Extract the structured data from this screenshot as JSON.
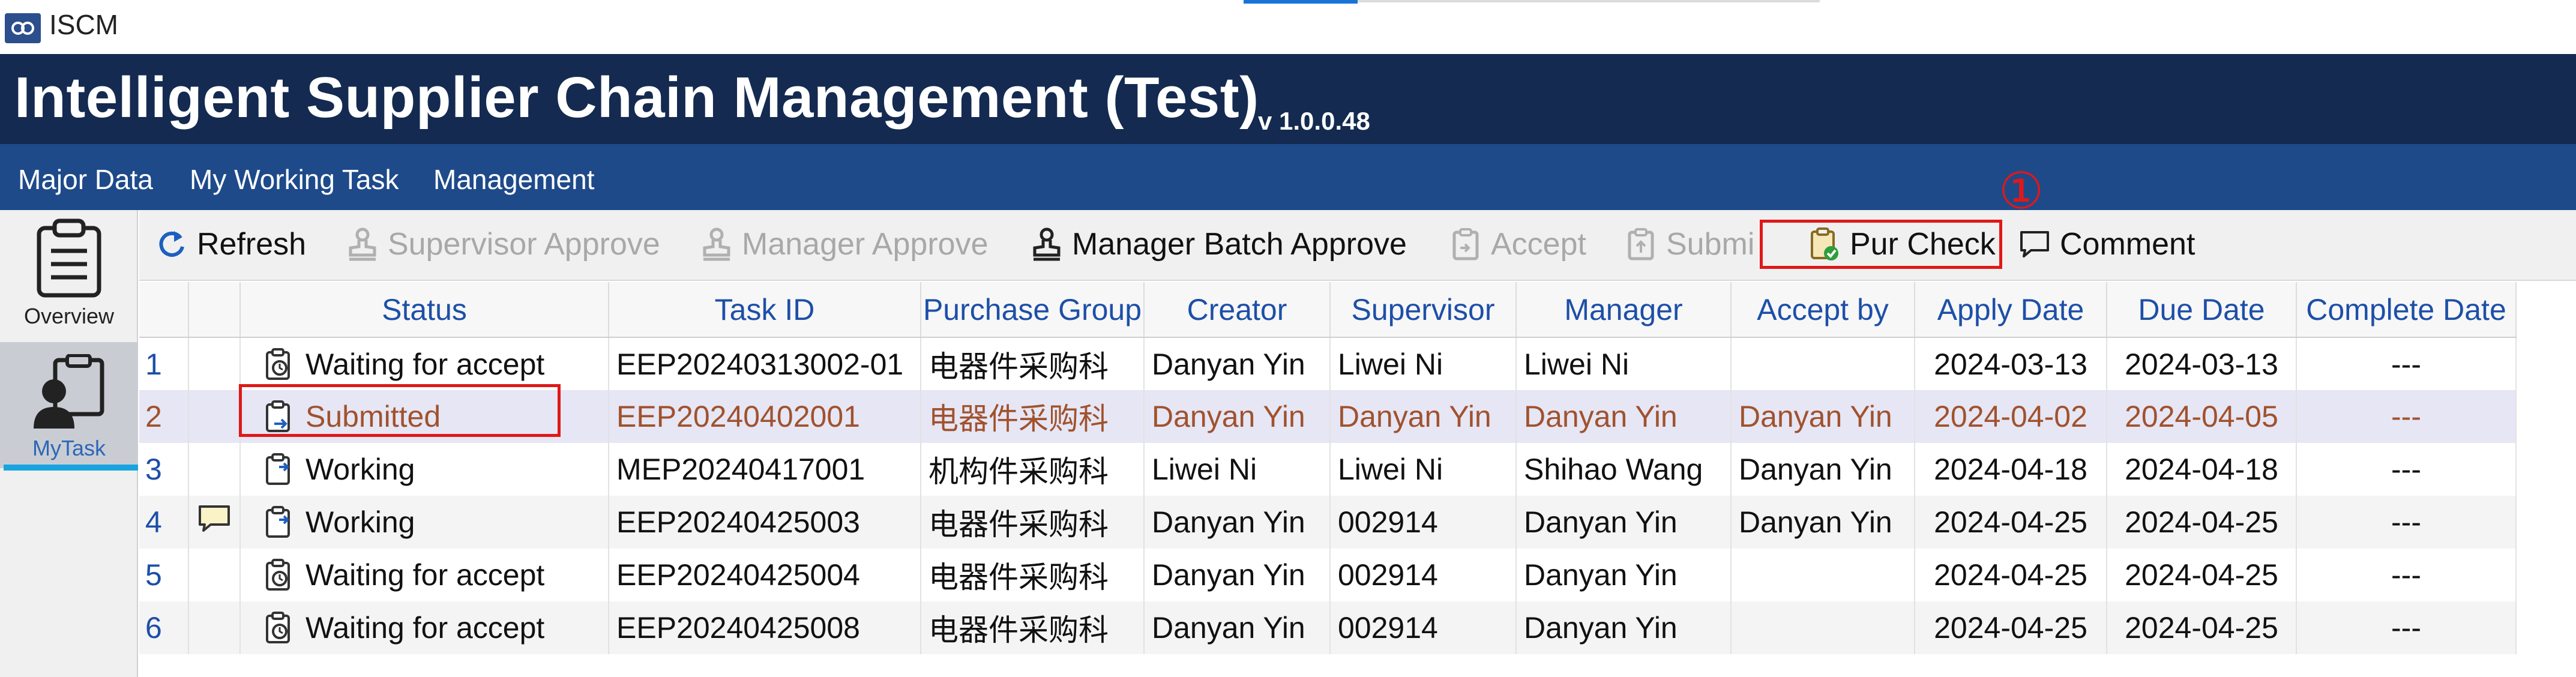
{
  "window": {
    "title": "ISCM"
  },
  "header": {
    "app_name": "Intelligent Supplier Chain Management (Test)",
    "version": "v 1.0.0.48"
  },
  "menu": {
    "items": [
      {
        "label": "Major Data"
      },
      {
        "label": "My Working Task"
      },
      {
        "label": "Management"
      }
    ]
  },
  "sidebar": {
    "items": [
      {
        "label": "Overview",
        "icon": "clipboard-list-icon"
      },
      {
        "label": "MyTask",
        "icon": "person-task-icon",
        "selected": true
      }
    ]
  },
  "toolbar": {
    "buttons": [
      {
        "label": "Refresh",
        "icon": "refresh-icon",
        "enabled": true
      },
      {
        "label": "Supervisor Approve",
        "icon": "stamp-icon",
        "enabled": false
      },
      {
        "label": "Manager Approve",
        "icon": "stamp-icon",
        "enabled": false
      },
      {
        "label": "Manager Batch Approve",
        "icon": "stamp-icon",
        "enabled": true
      },
      {
        "label": "Accept",
        "icon": "clipboard-accept-icon",
        "enabled": false
      },
      {
        "label": "Submi",
        "icon": "clipboard-submit-icon",
        "enabled": false
      },
      {
        "label": "Pur Check",
        "icon": "clipboard-check-icon",
        "enabled": true,
        "highlighted": true
      },
      {
        "label": "Comment",
        "icon": "comment-icon",
        "enabled": true
      }
    ],
    "annotation_marker": "①"
  },
  "table": {
    "columns": [
      "",
      "",
      "Status",
      "Task ID",
      "Purchase Group",
      "Creator",
      "Supervisor",
      "Manager",
      "Accept by",
      "Apply Date",
      "Due Date",
      "Complete Date"
    ],
    "rows": [
      {
        "num": "1",
        "comment": false,
        "status": "Waiting for accept",
        "status_icon": "clock-clipboard-icon",
        "task_id": "EEP20240313002-01",
        "purchase_group": "电器件采购科",
        "creator": "Danyan Yin",
        "supervisor": "Liwei Ni",
        "manager": "Liwei Ni",
        "accept_by": "",
        "apply_date": "2024-03-13",
        "due_date": "2024-03-13",
        "complete_date": "---"
      },
      {
        "num": "2",
        "comment": false,
        "status": "Submitted",
        "status_icon": "submit-clipboard-icon",
        "task_id": "EEP20240402001",
        "purchase_group": "电器件采购科",
        "creator": "Danyan Yin",
        "supervisor": "Danyan Yin",
        "manager": "Danyan Yin",
        "accept_by": "Danyan Yin",
        "apply_date": "2024-04-02",
        "due_date": "2024-04-05",
        "complete_date": "---",
        "selected": true,
        "highlighted": true
      },
      {
        "num": "3",
        "comment": false,
        "status": "Working",
        "status_icon": "working-clipboard-icon",
        "task_id": "MEP20240417001",
        "purchase_group": "机构件采购科",
        "creator": "Liwei Ni",
        "supervisor": "Liwei Ni",
        "manager": "Shihao Wang",
        "accept_by": "Danyan Yin",
        "apply_date": "2024-04-18",
        "due_date": "2024-04-18",
        "complete_date": "---"
      },
      {
        "num": "4",
        "comment": true,
        "status": "Working",
        "status_icon": "working-clipboard-icon",
        "task_id": "EEP20240425003",
        "purchase_group": "电器件采购科",
        "creator": "Danyan Yin",
        "supervisor": "002914",
        "manager": "Danyan Yin",
        "accept_by": "Danyan Yin",
        "apply_date": "2024-04-25",
        "due_date": "2024-04-25",
        "complete_date": "---"
      },
      {
        "num": "5",
        "comment": false,
        "status": "Waiting for accept",
        "status_icon": "clock-clipboard-icon",
        "task_id": "EEP20240425004",
        "purchase_group": "电器件采购科",
        "creator": "Danyan Yin",
        "supervisor": "002914",
        "manager": "Danyan Yin",
        "accept_by": "",
        "apply_date": "2024-04-25",
        "due_date": "2024-04-25",
        "complete_date": "---"
      },
      {
        "num": "6",
        "comment": false,
        "status": "Waiting for accept",
        "status_icon": "clock-clipboard-icon",
        "task_id": "EEP20240425008",
        "purchase_group": "电器件采购科",
        "creator": "Danyan Yin",
        "supervisor": "002914",
        "manager": "Danyan Yin",
        "accept_by": "",
        "apply_date": "2024-04-25",
        "due_date": "2024-04-25",
        "complete_date": "---"
      }
    ]
  },
  "colors": {
    "header_bg": "#142a50",
    "menu_bg": "#1e4a8a",
    "column_header_text": "#1d4fa8",
    "selected_row_bg": "#e6e6f5",
    "selected_row_text": "#a0522d",
    "highlight_red": "#e01818",
    "tab_underline": "#19a3e0"
  }
}
